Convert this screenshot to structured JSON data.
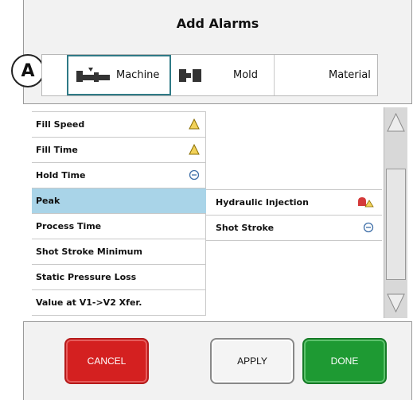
{
  "dialog": {
    "title": "Add Alarms",
    "callout": "A"
  },
  "tabs": [
    {
      "label": "Machine",
      "icon": "machine-icon",
      "selected": true
    },
    {
      "label": "Mold",
      "icon": "mold-icon",
      "selected": false
    },
    {
      "label": "Material",
      "icon": "",
      "selected": false
    }
  ],
  "left_items": [
    {
      "label": "Fill Speed",
      "icon": "warning-icon"
    },
    {
      "label": "Fill Time",
      "icon": "warning-icon"
    },
    {
      "label": "Hold Time",
      "icon": "minus-circle-icon"
    },
    {
      "label": "Peak",
      "icon": "",
      "selected": true
    },
    {
      "label": "Process Time",
      "icon": ""
    },
    {
      "label": "Shot Stroke Minimum",
      "icon": ""
    },
    {
      "label": "Static Pressure Loss",
      "icon": ""
    },
    {
      "label": "Value at V1->V2 Xfer.",
      "icon": ""
    }
  ],
  "right_items": [
    {
      "label": "Hydraulic Injection",
      "icon": "alarm-bell-warning-icon"
    },
    {
      "label": "Shot Stroke",
      "icon": "minus-circle-icon"
    }
  ],
  "buttons": {
    "cancel": "CANCEL",
    "apply": "APPLY",
    "done": "DONE"
  },
  "colors": {
    "selected_row": "#a9d4e8",
    "cancel": "#d42020",
    "done": "#1e9a33",
    "selected_tab_border": "#2f7a86"
  }
}
